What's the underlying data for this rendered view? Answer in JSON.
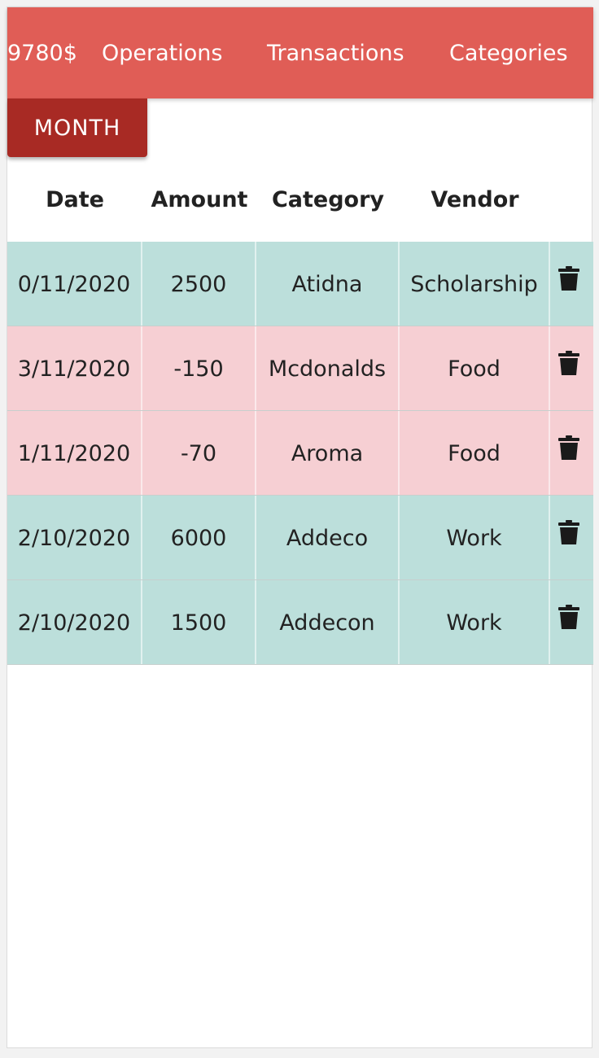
{
  "appbar": {
    "balance": "9780$",
    "nav": {
      "operations": "Operations",
      "transactions": "Transactions",
      "categories": "Categories"
    }
  },
  "filter": {
    "month_label": "MONTH"
  },
  "table": {
    "headers": {
      "date": "Date",
      "amount": "Amount",
      "category": "Category",
      "vendor": "Vendor"
    },
    "rows": [
      {
        "date": "0/11/2020",
        "amount": "2500",
        "category": "Atidna",
        "vendor": "Scholarship",
        "kind": "income"
      },
      {
        "date": "3/11/2020",
        "amount": "-150",
        "category": "Mcdonalds",
        "vendor": "Food",
        "kind": "expense"
      },
      {
        "date": "1/11/2020",
        "amount": "-70",
        "category": "Aroma",
        "vendor": "Food",
        "kind": "expense"
      },
      {
        "date": "2/10/2020",
        "amount": "6000",
        "category": "Addeco",
        "vendor": "Work",
        "kind": "income"
      },
      {
        "date": "2/10/2020",
        "amount": "1500",
        "category": "Addecon",
        "vendor": "Work",
        "kind": "income"
      }
    ],
    "delete_icon": "trash-icon"
  },
  "colors": {
    "appbar": "#e05d56",
    "month_button": "#a82a24",
    "income_row": "#bcdfdb",
    "expense_row": "#f6cfd3"
  }
}
